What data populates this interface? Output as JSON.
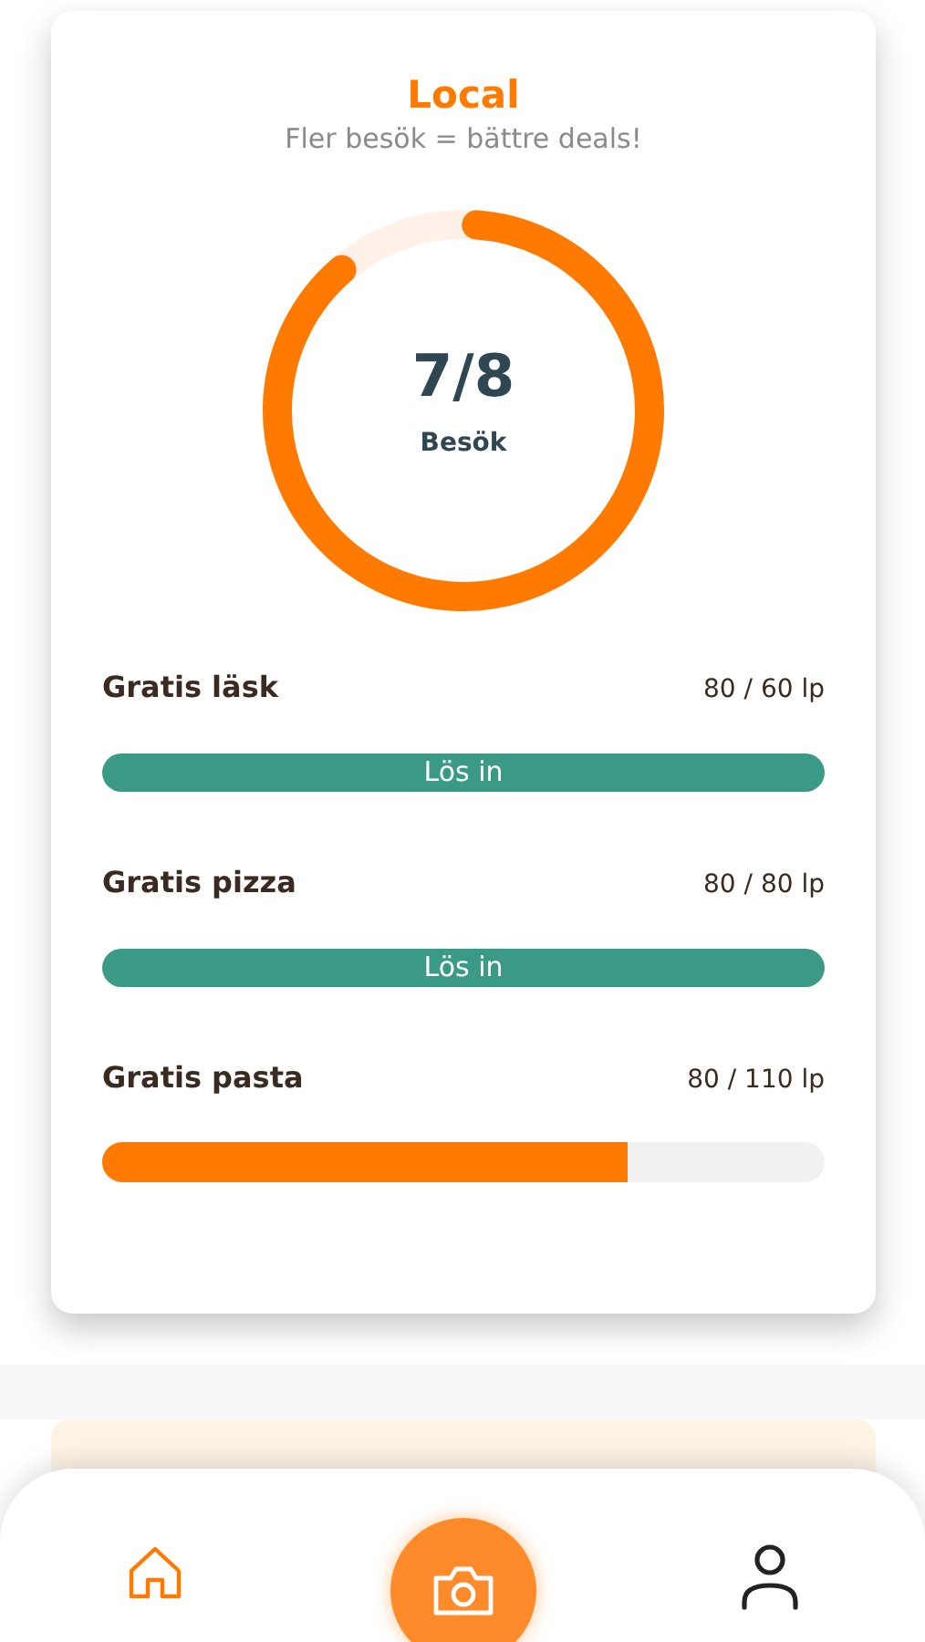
{
  "card": {
    "title": "Local",
    "subtitle": "Fler besök = bättre deals!",
    "visits": {
      "count": "7/8",
      "label": "Besök",
      "level": 0.875
    },
    "rewards": [
      {
        "name": "Gratis läsk",
        "points": "80 / 60 lp",
        "kind": "redeem",
        "action": "Lös in"
      },
      {
        "name": "Gratis pizza",
        "points": "80 / 80 lp",
        "kind": "redeem",
        "action": "Lös in"
      },
      {
        "name": "Gratis pasta",
        "points": "80 / 110 lp",
        "kind": "progress",
        "level": 0.727
      }
    ]
  },
  "nav": [
    {
      "kind": "home",
      "selected": true
    },
    {
      "kind": "camera",
      "selected": false
    },
    {
      "kind": "profile",
      "selected": false
    }
  ]
}
